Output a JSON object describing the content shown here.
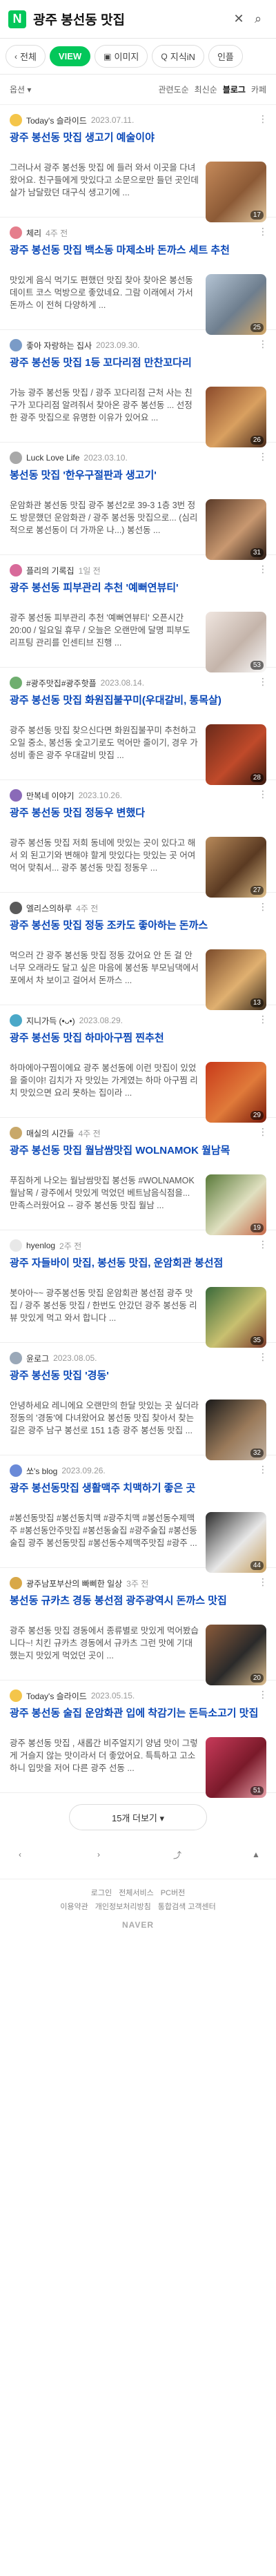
{
  "header": {
    "logo": "N",
    "query": "광주 봉선동 맛집"
  },
  "tabs": [
    {
      "icon": "‹",
      "label": "전체",
      "active": false
    },
    {
      "icon": "",
      "label": "VIEW",
      "active": true
    },
    {
      "icon": "▣",
      "label": "이미지",
      "active": false
    },
    {
      "icon": "Q",
      "label": "지식iN",
      "active": false
    },
    {
      "icon": "",
      "label": "인플",
      "active": false
    }
  ],
  "filter": {
    "left": "옵션 ▾",
    "sorts": [
      "관련도순",
      "최신순",
      "블로그",
      "카페"
    ],
    "active_sort": "블로그"
  },
  "posts": [
    {
      "author": "Today's 슬라이드",
      "date": "2023.07.11.",
      "title": "광주 봉선동 맛집 생고기 예술이야",
      "excerpt": "그러나서 광주 봉선동 맛집 에 들러 와서 이곳을 다녀왔어요. 친구들에게 맛있다고 소문으로만 들던 곳인데 살가 남달랐던 대구식 생고기에 ...",
      "avatar": "#f4c54a",
      "thumb": [
        "#c58a5a",
        "#8c5a36",
        "#e3c9a0"
      ],
      "count": "17"
    },
    {
      "author": "체리",
      "date": "4주 전",
      "title": "광주 봉선동 맛집 백소동 마제소바 돈까스 세트 추천",
      "excerpt": "맛있게 음식 먹기도 편했던 맛집 찾아 찾아온 봉선동 데이트 코스 먹방으로 좋았네요. 그람 이래에서 가서 돈까스 이 전혀 다양하게 ...",
      "avatar": "#e57e8c",
      "thumb": [
        "#b4c4d4",
        "#6e7e8e",
        "#d4a868"
      ],
      "count": "25"
    },
    {
      "author": "좋아 자랑하는 집사",
      "date": "2023.09.30.",
      "title": "광주 봉선동 맛집 1등 꼬다리점 만찬꼬다리",
      "excerpt": "가능 광주 봉선동 맛집 / 광주 꼬다리점 근처 사는 친구가 꼬다리점 알려줘서 찾아온 광주 봉선동 ... 선정한 광주 맛집으로 유명한 이유가 있어요 ...",
      "avatar": "#7a9bc7",
      "thumb": [
        "#8b4a2b",
        "#d9a060",
        "#4a2a1a"
      ],
      "count": "26"
    },
    {
      "author": "Luck Love Life",
      "date": "2023.03.10.",
      "title": "봉선동 맛집 '한우구절판과 생고기'",
      "excerpt": "운암화관 봉선동 맛집 광주 봉선2로 39-3 1층 3번 정도 방문했던 운암화관 / 광주 봉선동 맛집으로... (심리적으로 봉선동이 더 가까운 나...) 봉선동 ...",
      "avatar": "#a8a8a8",
      "thumb": [
        "#5a3a28",
        "#c89870",
        "#2a1a12"
      ],
      "count": "31"
    },
    {
      "author": "플리의 기록집",
      "date": "1일 전",
      "title": "광주 봉선동 피부관리 추천 '예뻐연뷰티'",
      "excerpt": "광주 봉선동 피부관리 추천 '예뻐연뷰티' 오픈시간 20:00 / 일요일 휴무 / 오늘은 오랜만에 달명 피부도 리프팅 관리를 인센티브 진행 ...",
      "avatar": "#d86a9a",
      "thumb": [
        "#f0e6e0",
        "#c4b4aa",
        "#fafafa"
      ],
      "count": "53"
    },
    {
      "author": "#광주맛집#광주핫플",
      "date": "2023.08.14.",
      "title": "광주 봉선동 맛집 화원집불꾸미(우대갈비, 통목살)",
      "excerpt": "광주 봉선동 맛집 찾으신다면 화원집불꾸미 추천하고 오일 중소, 봉선동 숯고기로도 먹어만 줄이기, 경우 가성비 좋은 광주 우대갈비 맛집 ...",
      "avatar": "#6fae6f",
      "thumb": [
        "#6a2a1a",
        "#c04a2a",
        "#3a1a10"
      ],
      "count": "28"
    },
    {
      "author": "만복네 이야기",
      "date": "2023.10.26.",
      "title": "광주 봉선동 맛집 정동우 변했다",
      "excerpt": "광주 봉선동 맛집 저희 동네에 맛있는 곳이 있다고 해서 외 된고기와 변해야 할게 맛있다는 맛있는 곳 어여 먹어 맞춰서... 광주 봉선동 맛집 정동우 ...",
      "avatar": "#8a6ab8",
      "thumb": [
        "#b88a5a",
        "#5a3a22",
        "#e0c08a"
      ],
      "count": "27"
    },
    {
      "author": "엘리스의하루",
      "date": "4주 전",
      "title": "광주 봉선동 맛집 정동 조카도 좋아하는 돈까스",
      "excerpt": "먹으러 간 광주 봉선동 맛집 정동 갔어요 안 돈 걸 안 너무 오래라도 달고 싶은 마음에 봉선동 부모님댁에서 포에서 차 보이고 걸어서 돈까스 ...",
      "avatar": "#5a5a5a",
      "thumb": [
        "#7a4a2a",
        "#e0b070",
        "#3a2a1a"
      ],
      "count": "13"
    },
    {
      "author": "지니가득 (•ᴗ•)",
      "date": "2023.08.29.",
      "title": "광주 봉선동 맛집 하마아구찜 찐추천",
      "excerpt": "하마에아구찜이에요 광주 봉선동에 이런 맛집이 있었을 줄이야! 김치가 자 맛있는 가게였는 하마 아구찜 리치 맛있으면 요리 못하는 집이라 ...",
      "avatar": "#4aa8c8",
      "thumb": [
        "#c83a1a",
        "#e07a3a",
        "#7a1a0a"
      ],
      "count": "29"
    },
    {
      "author": "매실의 시간들",
      "date": "4주 전",
      "title": "광주 봉선동 맛집 월남쌈맛집 WOLNAMOK 월남목",
      "excerpt": "푸짐하게 나오는 월남쌈맛집 봉선동 #WOLNAMOK 월남목 / 광주에서 맛있게 먹었던 베트남음식점을... 만족스러웠어요 -- 광주 봉선동 맛집 월남 ...",
      "avatar": "#c8a86a",
      "thumb": [
        "#5a7a3a",
        "#e0e0c0",
        "#c86a4a"
      ],
      "count": "19"
    },
    {
      "author": "hyenlog",
      "date": "2주 전",
      "title": "광주 자들바이 맛집, 봉선동 맛집, 운암회관 봉선점",
      "excerpt": "봇아아~~ 광주봉선동 맛집 운암회관 봉선점 광주 맛집 / 광주 봉선동 맛집 / 한번도 안갔던 광주 봉선동 리뷰 맛있게 먹고 와서 합니다 ...",
      "avatar": "#e8e8e8",
      "thumb": [
        "#3a6a3a",
        "#c8c070",
        "#7a3a2a"
      ],
      "count": "35"
    },
    {
      "author": "윤로그",
      "date": "2023.08.05.",
      "title": "광주 봉선동 맛집 '경동'",
      "excerpt": "안녕하세요 레니에요 오랜만의 한달 맛있는 곳 싶더라 정동의 '경동'에 다녀왔어요 봉선동 맛집 찾아서 찾는 길은 광주 남구 봉선로 151 1층 광주 봉선동 맛집 ...",
      "avatar": "#9aa8b8",
      "thumb": [
        "#1a1a1a",
        "#9a7a5a",
        "#c0b0a0"
      ],
      "count": "32"
    },
    {
      "author": "쏘's blog",
      "date": "2023.09.26.",
      "title": "광주 봉선동맛집 생활맥주 치맥하기 좋은 곳",
      "excerpt": "#봉선동맛집 #봉선동치맥 #광주치맥 #봉선동수제맥주 #봉선동안주맛집 #봉선동술집 #광주술집 #봉선동술집 광주 봉선동맛집 #봉선동수제맥주맛집 #광주 ...",
      "avatar": "#6a8ad8",
      "thumb": [
        "#2a2a2a",
        "#e8e8e8",
        "#c8a060"
      ],
      "count": "44"
    },
    {
      "author": "광주남포부산의 빠삐한 일상",
      "date": "3주 전",
      "title": "봉선동 규카츠 경동 봉선점 광주광역시 돈까스 맛집",
      "excerpt": "광주 봉선동 맛집 경동에서 종류별로 맛있게 먹어봤습니다~! 치킨 규카츠 경동에서 규카츠 그런 맛에 기대했는지 맛있게 먹었던 곳이 ...",
      "avatar": "#d8a848",
      "thumb": [
        "#8a5a3a",
        "#2a2a2a",
        "#e0c090"
      ],
      "count": "20"
    },
    {
      "author": "Today's 슬라이드",
      "date": "2023.05.15.",
      "title": "광주 봉선동 술집 운암화관 입에 착감기는 돈득소고기 맛집",
      "excerpt": "광주 봉선동 맛집 , 새롭간 비주얼지기 양념 맛이 그렇게 거슬지 않는 맛이라서 더 좋았어요. 특특하고 고소하니 입맛을 저어 다른 광주 선동 ...",
      "avatar": "#f4c54a",
      "thumb": [
        "#c83a5a",
        "#7a1a2a",
        "#e8a0a8"
      ],
      "count": "51"
    }
  ],
  "more_button": "15개 더보기 ▾",
  "footer": {
    "links": [
      "로그인",
      "전체서비스",
      "PC버전"
    ],
    "links2": [
      "이용약관",
      "개인정보처리방침",
      "통합검색 고객센터"
    ],
    "brand": "NAVER"
  }
}
